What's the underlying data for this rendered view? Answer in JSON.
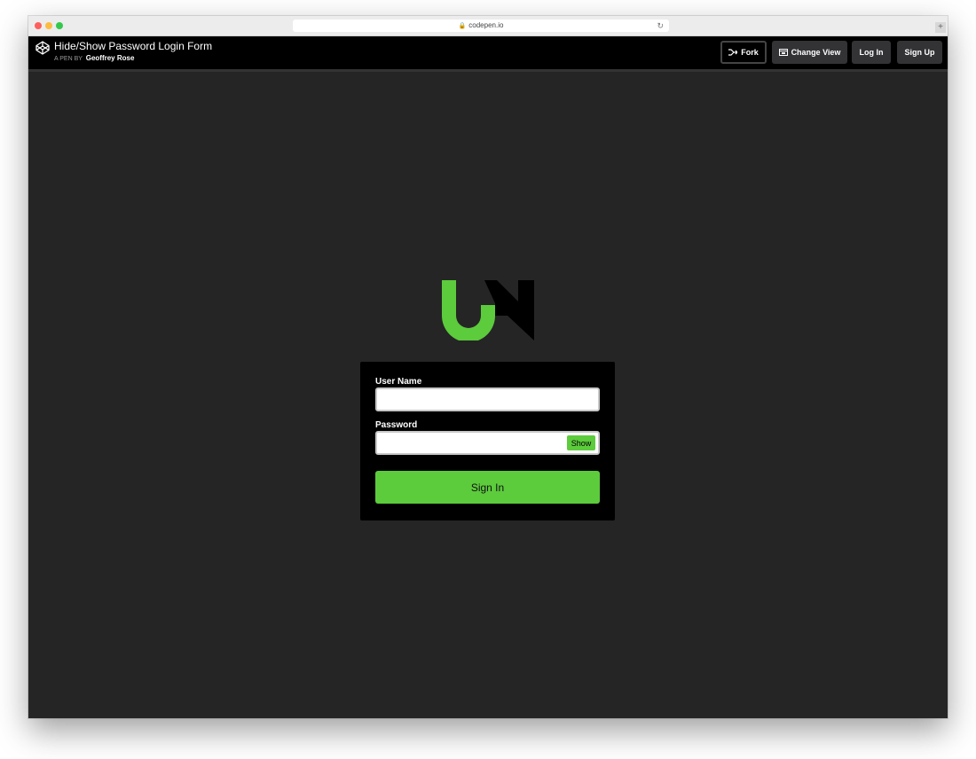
{
  "browser": {
    "url": "codepen.io"
  },
  "header": {
    "title": "Hide/Show Password Login Form",
    "byline_prefix": "A PEN BY",
    "author": "Geoffrey Rose",
    "buttons": {
      "fork": "Fork",
      "change_view": "Change View",
      "login": "Log In",
      "signup": "Sign Up"
    }
  },
  "form": {
    "username_label": "User Name",
    "username_value": "",
    "password_label": "Password",
    "password_value": "",
    "show_label": "Show",
    "submit_label": "Sign In"
  },
  "colors": {
    "accent": "#5ccb3c",
    "page_background": "#252525",
    "header_background": "#000000",
    "card_background": "#000000"
  },
  "icons": {
    "codepen": "codepen-icon",
    "fork": "fork-icon",
    "change_view": "change-view-icon",
    "lock": "lock-icon",
    "reload": "reload-icon"
  }
}
